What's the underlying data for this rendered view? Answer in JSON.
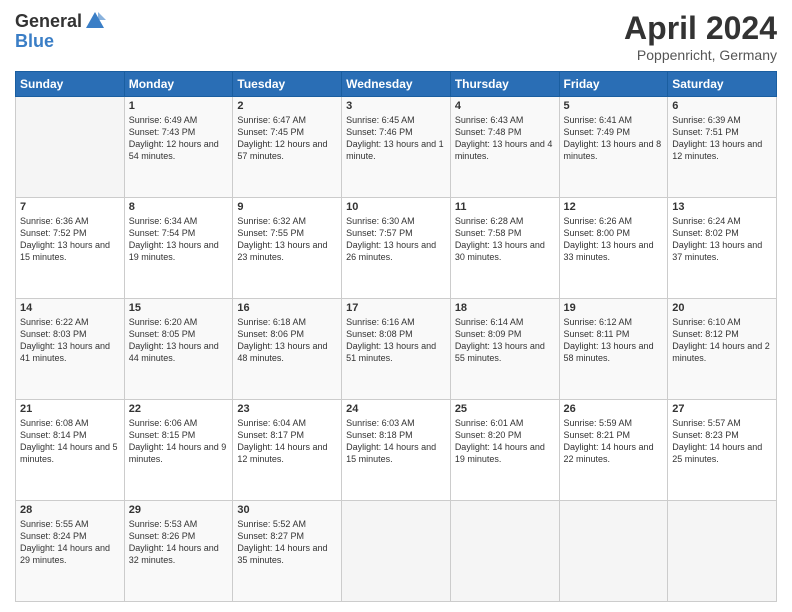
{
  "header": {
    "logo_general": "General",
    "logo_blue": "Blue",
    "title": "April 2024",
    "location": "Poppenricht, Germany"
  },
  "days_of_week": [
    "Sunday",
    "Monday",
    "Tuesday",
    "Wednesday",
    "Thursday",
    "Friday",
    "Saturday"
  ],
  "weeks": [
    [
      {
        "day": "",
        "sunrise": "",
        "sunset": "",
        "daylight": ""
      },
      {
        "day": "1",
        "sunrise": "Sunrise: 6:49 AM",
        "sunset": "Sunset: 7:43 PM",
        "daylight": "Daylight: 12 hours and 54 minutes."
      },
      {
        "day": "2",
        "sunrise": "Sunrise: 6:47 AM",
        "sunset": "Sunset: 7:45 PM",
        "daylight": "Daylight: 12 hours and 57 minutes."
      },
      {
        "day": "3",
        "sunrise": "Sunrise: 6:45 AM",
        "sunset": "Sunset: 7:46 PM",
        "daylight": "Daylight: 13 hours and 1 minute."
      },
      {
        "day": "4",
        "sunrise": "Sunrise: 6:43 AM",
        "sunset": "Sunset: 7:48 PM",
        "daylight": "Daylight: 13 hours and 4 minutes."
      },
      {
        "day": "5",
        "sunrise": "Sunrise: 6:41 AM",
        "sunset": "Sunset: 7:49 PM",
        "daylight": "Daylight: 13 hours and 8 minutes."
      },
      {
        "day": "6",
        "sunrise": "Sunrise: 6:39 AM",
        "sunset": "Sunset: 7:51 PM",
        "daylight": "Daylight: 13 hours and 12 minutes."
      }
    ],
    [
      {
        "day": "7",
        "sunrise": "Sunrise: 6:36 AM",
        "sunset": "Sunset: 7:52 PM",
        "daylight": "Daylight: 13 hours and 15 minutes."
      },
      {
        "day": "8",
        "sunrise": "Sunrise: 6:34 AM",
        "sunset": "Sunset: 7:54 PM",
        "daylight": "Daylight: 13 hours and 19 minutes."
      },
      {
        "day": "9",
        "sunrise": "Sunrise: 6:32 AM",
        "sunset": "Sunset: 7:55 PM",
        "daylight": "Daylight: 13 hours and 23 minutes."
      },
      {
        "day": "10",
        "sunrise": "Sunrise: 6:30 AM",
        "sunset": "Sunset: 7:57 PM",
        "daylight": "Daylight: 13 hours and 26 minutes."
      },
      {
        "day": "11",
        "sunrise": "Sunrise: 6:28 AM",
        "sunset": "Sunset: 7:58 PM",
        "daylight": "Daylight: 13 hours and 30 minutes."
      },
      {
        "day": "12",
        "sunrise": "Sunrise: 6:26 AM",
        "sunset": "Sunset: 8:00 PM",
        "daylight": "Daylight: 13 hours and 33 minutes."
      },
      {
        "day": "13",
        "sunrise": "Sunrise: 6:24 AM",
        "sunset": "Sunset: 8:02 PM",
        "daylight": "Daylight: 13 hours and 37 minutes."
      }
    ],
    [
      {
        "day": "14",
        "sunrise": "Sunrise: 6:22 AM",
        "sunset": "Sunset: 8:03 PM",
        "daylight": "Daylight: 13 hours and 41 minutes."
      },
      {
        "day": "15",
        "sunrise": "Sunrise: 6:20 AM",
        "sunset": "Sunset: 8:05 PM",
        "daylight": "Daylight: 13 hours and 44 minutes."
      },
      {
        "day": "16",
        "sunrise": "Sunrise: 6:18 AM",
        "sunset": "Sunset: 8:06 PM",
        "daylight": "Daylight: 13 hours and 48 minutes."
      },
      {
        "day": "17",
        "sunrise": "Sunrise: 6:16 AM",
        "sunset": "Sunset: 8:08 PM",
        "daylight": "Daylight: 13 hours and 51 minutes."
      },
      {
        "day": "18",
        "sunrise": "Sunrise: 6:14 AM",
        "sunset": "Sunset: 8:09 PM",
        "daylight": "Daylight: 13 hours and 55 minutes."
      },
      {
        "day": "19",
        "sunrise": "Sunrise: 6:12 AM",
        "sunset": "Sunset: 8:11 PM",
        "daylight": "Daylight: 13 hours and 58 minutes."
      },
      {
        "day": "20",
        "sunrise": "Sunrise: 6:10 AM",
        "sunset": "Sunset: 8:12 PM",
        "daylight": "Daylight: 14 hours and 2 minutes."
      }
    ],
    [
      {
        "day": "21",
        "sunrise": "Sunrise: 6:08 AM",
        "sunset": "Sunset: 8:14 PM",
        "daylight": "Daylight: 14 hours and 5 minutes."
      },
      {
        "day": "22",
        "sunrise": "Sunrise: 6:06 AM",
        "sunset": "Sunset: 8:15 PM",
        "daylight": "Daylight: 14 hours and 9 minutes."
      },
      {
        "day": "23",
        "sunrise": "Sunrise: 6:04 AM",
        "sunset": "Sunset: 8:17 PM",
        "daylight": "Daylight: 14 hours and 12 minutes."
      },
      {
        "day": "24",
        "sunrise": "Sunrise: 6:03 AM",
        "sunset": "Sunset: 8:18 PM",
        "daylight": "Daylight: 14 hours and 15 minutes."
      },
      {
        "day": "25",
        "sunrise": "Sunrise: 6:01 AM",
        "sunset": "Sunset: 8:20 PM",
        "daylight": "Daylight: 14 hours and 19 minutes."
      },
      {
        "day": "26",
        "sunrise": "Sunrise: 5:59 AM",
        "sunset": "Sunset: 8:21 PM",
        "daylight": "Daylight: 14 hours and 22 minutes."
      },
      {
        "day": "27",
        "sunrise": "Sunrise: 5:57 AM",
        "sunset": "Sunset: 8:23 PM",
        "daylight": "Daylight: 14 hours and 25 minutes."
      }
    ],
    [
      {
        "day": "28",
        "sunrise": "Sunrise: 5:55 AM",
        "sunset": "Sunset: 8:24 PM",
        "daylight": "Daylight: 14 hours and 29 minutes."
      },
      {
        "day": "29",
        "sunrise": "Sunrise: 5:53 AM",
        "sunset": "Sunset: 8:26 PM",
        "daylight": "Daylight: 14 hours and 32 minutes."
      },
      {
        "day": "30",
        "sunrise": "Sunrise: 5:52 AM",
        "sunset": "Sunset: 8:27 PM",
        "daylight": "Daylight: 14 hours and 35 minutes."
      },
      {
        "day": "",
        "sunrise": "",
        "sunset": "",
        "daylight": ""
      },
      {
        "day": "",
        "sunrise": "",
        "sunset": "",
        "daylight": ""
      },
      {
        "day": "",
        "sunrise": "",
        "sunset": "",
        "daylight": ""
      },
      {
        "day": "",
        "sunrise": "",
        "sunset": "",
        "daylight": ""
      }
    ]
  ]
}
